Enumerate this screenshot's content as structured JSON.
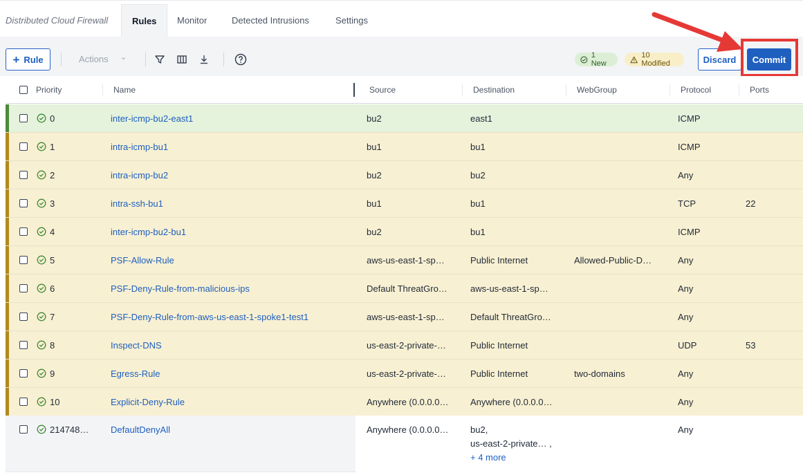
{
  "app_title": "Distributed Cloud Firewall",
  "tabs": [
    {
      "label": "Rules"
    },
    {
      "label": "Monitor"
    },
    {
      "label": "Detected Intrusions"
    },
    {
      "label": "Settings"
    }
  ],
  "toolbar": {
    "add_rule_label": "Rule",
    "actions_label": "Actions",
    "icons": [
      "filter-icon",
      "columns-icon",
      "download-icon",
      "help-icon"
    ],
    "new_badge": "1 New",
    "modified_badge": "10 Modified",
    "discard_label": "Discard",
    "commit_label": "Commit"
  },
  "colors": {
    "accent": "#1f5fbf",
    "new_row": "#e5f2dc",
    "modified_row": "#f8f0d2",
    "highlight_box": "#e53935"
  },
  "table": {
    "headers": {
      "priority": "Priority",
      "name": "Name",
      "source": "Source",
      "destination": "Destination",
      "webgroup": "WebGroup",
      "protocol": "Protocol",
      "ports": "Ports"
    },
    "rows": [
      {
        "priority": "0",
        "name": "inter-icmp-bu2-east1",
        "source": "bu2",
        "destination": "east1",
        "webgroup": "",
        "protocol": "ICMP",
        "ports": ""
      },
      {
        "priority": "1",
        "name": "intra-icmp-bu1",
        "source": "bu1",
        "destination": "bu1",
        "webgroup": "",
        "protocol": "ICMP",
        "ports": ""
      },
      {
        "priority": "2",
        "name": "intra-icmp-bu2",
        "source": "bu2",
        "destination": "bu2",
        "webgroup": "",
        "protocol": "Any",
        "ports": ""
      },
      {
        "priority": "3",
        "name": "intra-ssh-bu1",
        "source": "bu1",
        "destination": "bu1",
        "webgroup": "",
        "protocol": "TCP",
        "ports": "22"
      },
      {
        "priority": "4",
        "name": "inter-icmp-bu2-bu1",
        "source": "bu2",
        "destination": "bu1",
        "webgroup": "",
        "protocol": "ICMP",
        "ports": ""
      },
      {
        "priority": "5",
        "name": "PSF-Allow-Rule",
        "source": "aws-us-east-1-sp…",
        "destination": "Public Internet",
        "webgroup": "Allowed-Public-D…",
        "protocol": "Any",
        "ports": ""
      },
      {
        "priority": "6",
        "name": "PSF-Deny-Rule-from-malicious-ips",
        "source": "Default ThreatGro…",
        "destination": "aws-us-east-1-sp…",
        "webgroup": "",
        "protocol": "Any",
        "ports": ""
      },
      {
        "priority": "7",
        "name": "PSF-Deny-Rule-from-aws-us-east-1-spoke1-test1",
        "source": "aws-us-east-1-sp…",
        "destination": "Default ThreatGro…",
        "webgroup": "",
        "protocol": "Any",
        "ports": ""
      },
      {
        "priority": "8",
        "name": "Inspect-DNS",
        "source": "us-east-2-private-…",
        "destination": "Public Internet",
        "webgroup": "",
        "protocol": "UDP",
        "ports": "53"
      },
      {
        "priority": "9",
        "name": "Egress-Rule",
        "source": "us-east-2-private-…",
        "destination": "Public Internet",
        "webgroup": "two-domains",
        "protocol": "Any",
        "ports": ""
      },
      {
        "priority": "10",
        "name": "Explicit-Deny-Rule",
        "source": "Anywhere (0.0.0.0…",
        "destination": "Anywhere (0.0.0.0…",
        "webgroup": "",
        "protocol": "Any",
        "ports": ""
      }
    ],
    "default_row": {
      "priority": "214748…",
      "name": "DefaultDenyAll",
      "source": "Anywhere (0.0.0.0…",
      "destination_line1": "bu2,",
      "destination_line2": "us-east-2-private… ,",
      "destination_more": "+ 4 more",
      "protocol": "Any"
    }
  }
}
